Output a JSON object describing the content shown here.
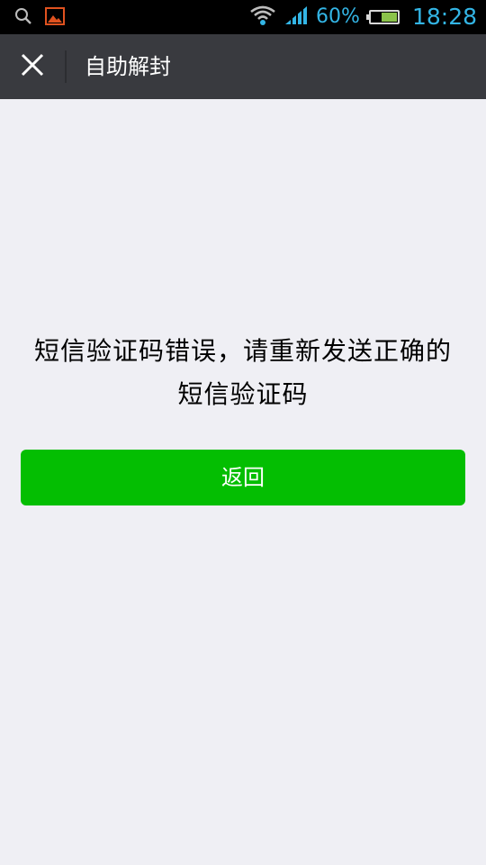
{
  "status_bar": {
    "icons": [
      "search-icon",
      "gallery-icon",
      "wifi-icon",
      "signal-icon",
      "battery-icon"
    ],
    "battery_percent": "60%",
    "battery_level": 0.6,
    "time": "18:28",
    "accent_color": "#33b5e5"
  },
  "header": {
    "title": "自助解封",
    "close_icon": "close-icon",
    "background": "#393a3f"
  },
  "main": {
    "message": "短信验证码错误，请重新发送正确的短信验证码",
    "back_button_label": "返回",
    "button_color": "#04be02",
    "background": "#efeff4"
  }
}
